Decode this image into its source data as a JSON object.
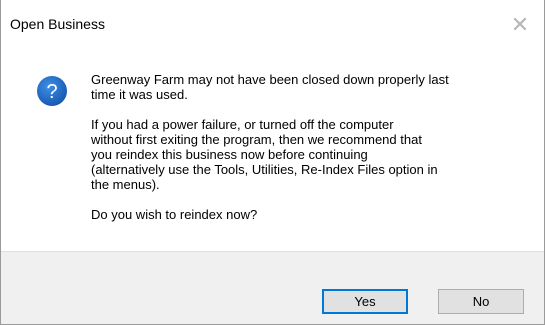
{
  "dialog": {
    "title": "Open Business",
    "close_glyph": "✕",
    "icon": "question-icon",
    "message": [
      "Greenway Farm may not have been closed down properly last\ntime it was used.",
      "If you had a power failure, or turned off the computer\nwithout first exiting the program, then we recommend that\nyou reindex this business now before continuing\n(alternatively use the Tools, Utilities, Re-Index Files option in\nthe menus).",
      "Do you wish to reindex now?"
    ],
    "buttons": {
      "yes": "Yes",
      "no": "No"
    }
  },
  "colors": {
    "icon_blue": "#1E69C2",
    "default_button_border": "#0078d7",
    "button_bar": "#f0f0f0"
  }
}
